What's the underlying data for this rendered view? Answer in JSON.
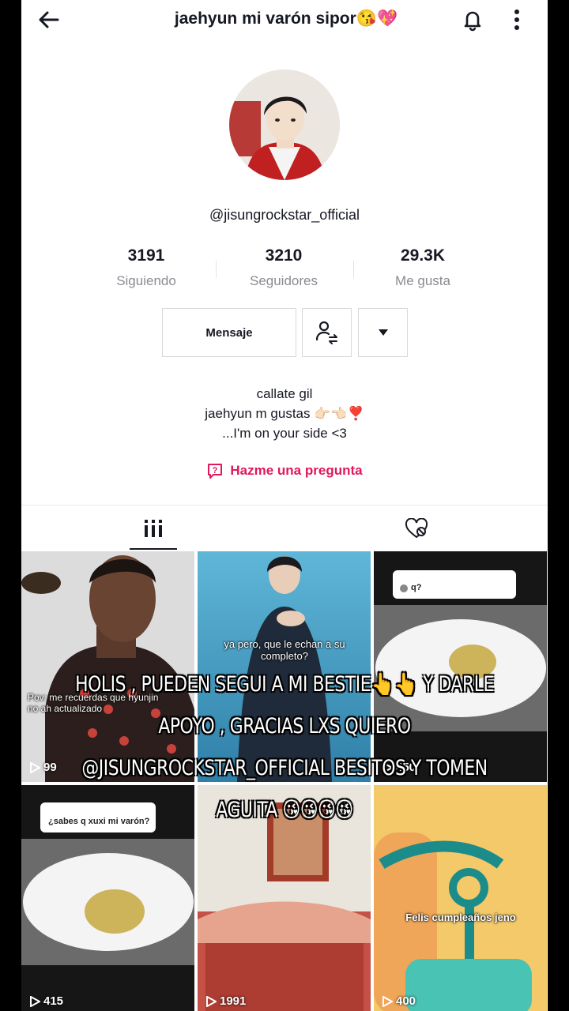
{
  "header": {
    "title": "jaehyun mi varón sipor😘💖"
  },
  "profile": {
    "handle": "@jisungrockstar_official",
    "stats": [
      {
        "value": "3191",
        "label": "Siguiendo"
      },
      {
        "value": "3210",
        "label": "Seguidores"
      },
      {
        "value": "29.3K",
        "label": "Me gusta"
      }
    ],
    "buttons": {
      "message_label": "Mensaje"
    },
    "bio": [
      "callate gil",
      "jaehyun m gustas 👉🏻👈🏻❣️",
      "...I'm on your side <3"
    ],
    "ask_label": "Hazme una pregunta"
  },
  "videos": [
    {
      "caption": "Pov: me recuerdas que hyunjin no ah actualizado",
      "views": "99"
    },
    {
      "caption": "ya pero, que le echan a su completo?",
      "views": ""
    },
    {
      "caption": "q?",
      "views": "450"
    },
    {
      "caption": "¿sabes q xuxi mi varón?",
      "views": "415"
    },
    {
      "caption": "",
      "views": "1991"
    },
    {
      "caption": "Felis cumpleaños jeno",
      "views": "400"
    }
  ],
  "overlay_text": [
    "HOLIS , PUEDEN SEGUI A MI BESTIE👆👆 Y DARLE",
    "APOYO , GRACIAS LXS QUIERO",
    "@JISUNGROCKSTAR_OFFICIAL  BESITOS Y TOMEN",
    "AGUITA 😘😘😘😘"
  ],
  "colors": {
    "accent": "#e1185a",
    "text": "#161823",
    "muted": "#8a8b91"
  }
}
